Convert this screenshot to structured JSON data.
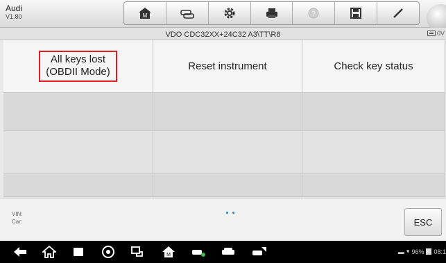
{
  "header": {
    "brand": "Audi",
    "version": "V1.80",
    "tools": [
      "home-icon",
      "vehicle-swap-icon",
      "settings-icon",
      "print-icon",
      "help-icon",
      "save-icon",
      "edit-icon"
    ]
  },
  "subbar": {
    "path": "VDO CDC32XX+24C32 A3\\TT\\R8",
    "battery_label": "0V"
  },
  "functions": [
    {
      "label": "All keys lost\n(OBDII Mode)",
      "selected": true
    },
    {
      "label": "Reset instrument",
      "selected": false
    },
    {
      "label": "Check key status",
      "selected": false
    }
  ],
  "footer": {
    "vin_label": "VIN:",
    "car_label": "Car:",
    "esc_label": "ESC"
  },
  "statusbar": {
    "battery": "96%",
    "time": "08:1"
  },
  "colors": {
    "highlight": "#e21d24",
    "page_dot": "#2a7fd4"
  }
}
